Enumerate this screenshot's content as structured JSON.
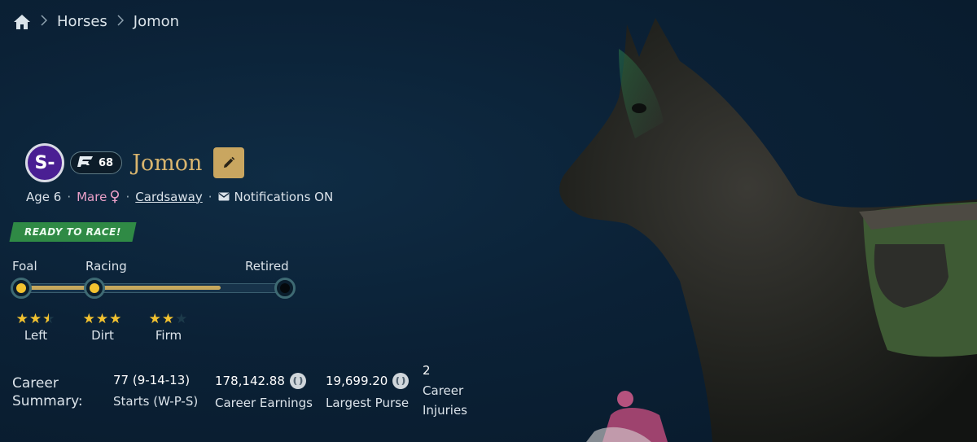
{
  "breadcrumb": {
    "home_icon": "home-icon",
    "items": [
      "Horses",
      "Jomon"
    ],
    "separator": ">"
  },
  "horse": {
    "grade": "S-",
    "rating": "68",
    "name": "Jomon",
    "age": "Age 6",
    "sex": "Mare",
    "sex_icon": "♀",
    "owner": "Cardsaway",
    "notifications": "Notifications ON",
    "status_badge": "READY TO RACE!"
  },
  "lifecycle": {
    "stages": [
      "Foal",
      "Racing",
      "Retired"
    ],
    "current_stage": "Racing",
    "progress": 0.74
  },
  "preferences": [
    {
      "label": "Left",
      "stars": 2.5
    },
    {
      "label": "Dirt",
      "stars": 3
    },
    {
      "label": "Firm",
      "stars": 2
    }
  ],
  "career": {
    "title_line1": "Career",
    "title_line2": "Summary:",
    "starts_value": "77 (9-14-13)",
    "starts_label": "Starts (W-P-S)",
    "earnings_value": "178,142.88",
    "earnings_label": "Career Earnings",
    "purse_value": "19,699.20",
    "purse_label": "Largest Purse",
    "injuries_value": "2",
    "injuries_label_line1": "Career",
    "injuries_label_line2": "Injuries"
  },
  "colors": {
    "background": "#0b2136",
    "gold": "#d9b56e",
    "badge_purple": "#4a1f93",
    "ready_green": "#2f8a45",
    "star_yellow": "#f2c230",
    "mare_pink": "#e9a0c8"
  }
}
